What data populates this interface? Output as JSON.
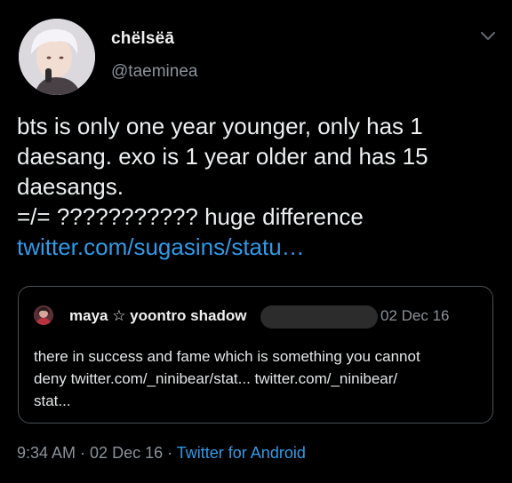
{
  "tweet": {
    "display_name": "chëlsëā",
    "handle": "@taeminea",
    "avatar_icon": "profile-photo",
    "caret_icon": "chevron-down-icon",
    "text_lines": [
      "bts is only one year younger, only has 1",
      "daesang. exo is 1 year older and has 15",
      "daesangs.",
      "=/= ??????????? huge difference"
    ],
    "link": "twitter.com/sugasins/statu…",
    "time": "9:34 AM",
    "date": "02 Dec 16",
    "separator": " · ",
    "source": "Twitter for Android"
  },
  "quote": {
    "name": "maya ☆ yoontro shadow",
    "date": "02 Dec 16",
    "text_lines": [
      "there in success and fame which is something you cannot",
      "deny twitter.com/_ninibear/stat... twitter.com/_ninibear/",
      "stat..."
    ]
  },
  "colors": {
    "background": "#000000",
    "text": "#eceff1",
    "secondary": "#8a9299",
    "link": "#2f9ae8",
    "border": "#4a4f55"
  }
}
